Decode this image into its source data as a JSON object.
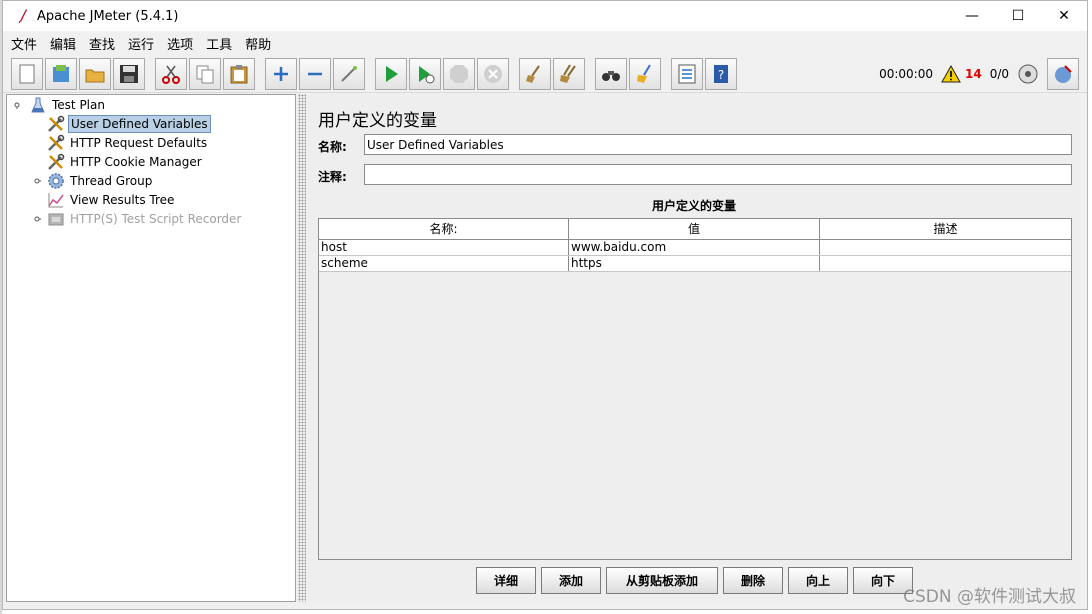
{
  "window": {
    "title": "Apache JMeter (5.4.1)",
    "controls": {
      "minimize": "—",
      "maximize": "☐",
      "close": "✕"
    }
  },
  "menu": [
    "文件",
    "编辑",
    "查找",
    "运行",
    "选项",
    "工具",
    "帮助"
  ],
  "toolbar": {
    "timer": "00:00:00",
    "error_count": "14",
    "threads": "0/0",
    "accent": "#e00000"
  },
  "tree": [
    {
      "label": "Test Plan",
      "icon": "flask-icon",
      "selected": false,
      "disabled": false
    },
    {
      "label": "User Defined Variables",
      "icon": "tools-icon",
      "selected": true,
      "disabled": false
    },
    {
      "label": "HTTP Request Defaults",
      "icon": "tools-icon",
      "selected": false,
      "disabled": false
    },
    {
      "label": "HTTP Cookie Manager",
      "icon": "tools-icon",
      "selected": false,
      "disabled": false
    },
    {
      "label": "Thread Group",
      "icon": "gear-icon",
      "selected": false,
      "disabled": false
    },
    {
      "label": "View Results Tree",
      "icon": "chart-icon",
      "selected": false,
      "disabled": false
    },
    {
      "label": "HTTP(S) Test Script Recorder",
      "icon": "recorder-icon",
      "selected": false,
      "disabled": true
    }
  ],
  "panel": {
    "title": "用户定义的变量",
    "name_label": "名称:",
    "name_value": "User Defined Variables",
    "comment_label": "注释:",
    "comment_value": "",
    "table_caption": "用户定义的变量"
  },
  "table": {
    "headers": [
      "名称:",
      "值",
      "描述"
    ],
    "rows": [
      [
        "host",
        "www.baidu.com",
        ""
      ],
      [
        "scheme",
        "https",
        ""
      ]
    ]
  },
  "buttons": [
    "详细",
    "添加",
    "从剪贴板添加",
    "删除",
    "向上",
    "向下"
  ],
  "watermark": "CSDN @软件测试大叔"
}
